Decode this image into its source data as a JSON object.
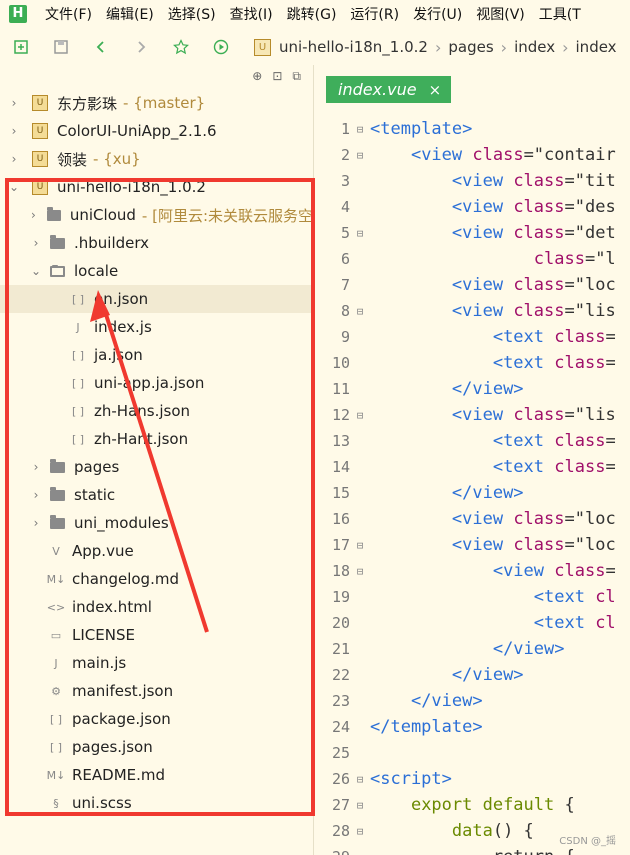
{
  "menubar": {
    "logo": "H",
    "items": [
      "文件(F)",
      "编辑(E)",
      "选择(S)",
      "查找(I)",
      "跳转(G)",
      "运行(R)",
      "发行(U)",
      "视图(V)",
      "工具(T"
    ]
  },
  "toolbar": {
    "breadcrumb": [
      "uni-hello-i18n_1.0.2",
      "pages",
      "index",
      "index"
    ]
  },
  "tree": [
    {
      "label": "东方影珠",
      "suffix": "- {master}",
      "type": "project",
      "twisty": "›"
    },
    {
      "label": "ColorUI-UniApp_2.1.6",
      "suffix": "",
      "type": "project",
      "twisty": "›"
    },
    {
      "label": "领装",
      "suffix": "- {xu}",
      "type": "project",
      "twisty": "›"
    },
    {
      "label": "uni-hello-i18n_1.0.2",
      "suffix": "",
      "type": "project",
      "twisty": "⌄"
    },
    {
      "label": "uniCloud",
      "suffix": "- [阿里云:未关联云服务空",
      "type": "folder",
      "twisty": "›"
    },
    {
      "label": ".hbuilderx",
      "suffix": "",
      "type": "folder",
      "twisty": "›"
    },
    {
      "label": "locale",
      "suffix": "",
      "type": "folder-open",
      "twisty": "⌄"
    },
    {
      "label": "en.json",
      "suffix": "",
      "type": "json",
      "twisty": ""
    },
    {
      "label": "index.js",
      "suffix": "",
      "type": "js",
      "twisty": ""
    },
    {
      "label": "ja.json",
      "suffix": "",
      "type": "json",
      "twisty": ""
    },
    {
      "label": "uni-app.ja.json",
      "suffix": "",
      "type": "json",
      "twisty": ""
    },
    {
      "label": "zh-Hans.json",
      "suffix": "",
      "type": "json",
      "twisty": ""
    },
    {
      "label": "zh-Hant.json",
      "suffix": "",
      "type": "json",
      "twisty": ""
    },
    {
      "label": "pages",
      "suffix": "",
      "type": "folder",
      "twisty": "›"
    },
    {
      "label": "static",
      "suffix": "",
      "type": "folder",
      "twisty": "›"
    },
    {
      "label": "uni_modules",
      "suffix": "",
      "type": "folder",
      "twisty": "›"
    },
    {
      "label": "App.vue",
      "suffix": "",
      "type": "vue",
      "twisty": ""
    },
    {
      "label": "changelog.md",
      "suffix": "",
      "type": "md",
      "twisty": ""
    },
    {
      "label": "index.html",
      "suffix": "",
      "type": "html",
      "twisty": ""
    },
    {
      "label": "LICENSE",
      "suffix": "",
      "type": "file",
      "twisty": ""
    },
    {
      "label": "main.js",
      "suffix": "",
      "type": "js",
      "twisty": ""
    },
    {
      "label": "manifest.json",
      "suffix": "",
      "type": "manifest",
      "twisty": ""
    },
    {
      "label": "package.json",
      "suffix": "",
      "type": "json",
      "twisty": ""
    },
    {
      "label": "pages.json",
      "suffix": "",
      "type": "json",
      "twisty": ""
    },
    {
      "label": "README.md",
      "suffix": "",
      "type": "md",
      "twisty": ""
    },
    {
      "label": "uni.scss",
      "suffix": "",
      "type": "scss",
      "twisty": ""
    }
  ],
  "editor": {
    "tab_label": "index.vue",
    "tab_close": "×",
    "lines": [
      {
        "n": "1",
        "fold": "⊟",
        "parts": [
          [
            "tag",
            "<template>"
          ]
        ]
      },
      {
        "n": "2",
        "fold": "⊟",
        "parts": [
          [
            "code",
            "    "
          ],
          [
            "tag",
            "<view "
          ],
          [
            "attr",
            "class"
          ],
          [
            "code",
            "=\"contair"
          ]
        ]
      },
      {
        "n": "3",
        "fold": "",
        "parts": [
          [
            "code",
            "        "
          ],
          [
            "tag",
            "<view "
          ],
          [
            "attr",
            "class"
          ],
          [
            "code",
            "=\"tit"
          ]
        ]
      },
      {
        "n": "4",
        "fold": "",
        "parts": [
          [
            "code",
            "        "
          ],
          [
            "tag",
            "<view "
          ],
          [
            "attr",
            "class"
          ],
          [
            "code",
            "=\"des"
          ]
        ]
      },
      {
        "n": "5",
        "fold": "⊟",
        "parts": [
          [
            "code",
            "        "
          ],
          [
            "tag",
            "<view "
          ],
          [
            "attr",
            "class"
          ],
          [
            "code",
            "=\"det"
          ]
        ]
      },
      {
        "n": "6",
        "fold": "",
        "parts": [
          [
            "code",
            "                "
          ],
          [
            "attr",
            "class"
          ],
          [
            "code",
            "=\"l"
          ]
        ]
      },
      {
        "n": "7",
        "fold": "",
        "parts": [
          [
            "code",
            "        "
          ],
          [
            "tag",
            "<view "
          ],
          [
            "attr",
            "class"
          ],
          [
            "code",
            "=\"loc"
          ]
        ]
      },
      {
        "n": "8",
        "fold": "⊟",
        "parts": [
          [
            "code",
            "        "
          ],
          [
            "tag",
            "<view "
          ],
          [
            "attr",
            "class"
          ],
          [
            "code",
            "=\"lis"
          ]
        ]
      },
      {
        "n": "9",
        "fold": "",
        "parts": [
          [
            "code",
            "            "
          ],
          [
            "tag",
            "<text "
          ],
          [
            "attr",
            "class"
          ],
          [
            "code",
            "="
          ]
        ]
      },
      {
        "n": "10",
        "fold": "",
        "parts": [
          [
            "code",
            "            "
          ],
          [
            "tag",
            "<text "
          ],
          [
            "attr",
            "class"
          ],
          [
            "code",
            "="
          ]
        ]
      },
      {
        "n": "11",
        "fold": "",
        "parts": [
          [
            "code",
            "        "
          ],
          [
            "tag",
            "</view>"
          ]
        ]
      },
      {
        "n": "12",
        "fold": "⊟",
        "parts": [
          [
            "code",
            "        "
          ],
          [
            "tag",
            "<view "
          ],
          [
            "attr",
            "class"
          ],
          [
            "code",
            "=\"lis"
          ]
        ]
      },
      {
        "n": "13",
        "fold": "",
        "parts": [
          [
            "code",
            "            "
          ],
          [
            "tag",
            "<text "
          ],
          [
            "attr",
            "class"
          ],
          [
            "code",
            "="
          ]
        ]
      },
      {
        "n": "14",
        "fold": "",
        "parts": [
          [
            "code",
            "            "
          ],
          [
            "tag",
            "<text "
          ],
          [
            "attr",
            "class"
          ],
          [
            "code",
            "="
          ]
        ]
      },
      {
        "n": "15",
        "fold": "",
        "parts": [
          [
            "code",
            "        "
          ],
          [
            "tag",
            "</view>"
          ]
        ]
      },
      {
        "n": "16",
        "fold": "",
        "parts": [
          [
            "code",
            "        "
          ],
          [
            "tag",
            "<view "
          ],
          [
            "attr",
            "class"
          ],
          [
            "code",
            "=\"loc"
          ]
        ]
      },
      {
        "n": "17",
        "fold": "⊟",
        "parts": [
          [
            "code",
            "        "
          ],
          [
            "tag",
            "<view "
          ],
          [
            "attr",
            "class"
          ],
          [
            "code",
            "=\"loc"
          ]
        ]
      },
      {
        "n": "18",
        "fold": "⊟",
        "parts": [
          [
            "code",
            "            "
          ],
          [
            "tag",
            "<view "
          ],
          [
            "attr",
            "class"
          ],
          [
            "code",
            "="
          ]
        ]
      },
      {
        "n": "19",
        "fold": "",
        "parts": [
          [
            "code",
            "                "
          ],
          [
            "tag",
            "<text "
          ],
          [
            "attr",
            "cl"
          ]
        ]
      },
      {
        "n": "20",
        "fold": "",
        "parts": [
          [
            "code",
            "                "
          ],
          [
            "tag",
            "<text "
          ],
          [
            "attr",
            "cl"
          ]
        ]
      },
      {
        "n": "21",
        "fold": "",
        "parts": [
          [
            "code",
            "            "
          ],
          [
            "tag",
            "</view>"
          ]
        ]
      },
      {
        "n": "22",
        "fold": "",
        "parts": [
          [
            "code",
            "        "
          ],
          [
            "tag",
            "</view>"
          ]
        ]
      },
      {
        "n": "23",
        "fold": "",
        "parts": [
          [
            "code",
            "    "
          ],
          [
            "tag",
            "</view>"
          ]
        ]
      },
      {
        "n": "24",
        "fold": "",
        "parts": [
          [
            "tag",
            "</template>"
          ]
        ]
      },
      {
        "n": "25",
        "fold": "",
        "parts": []
      },
      {
        "n": "26",
        "fold": "⊟",
        "parts": [
          [
            "tag",
            "<script>"
          ]
        ]
      },
      {
        "n": "27",
        "fold": "⊟",
        "parts": [
          [
            "code",
            "    "
          ],
          [
            "kw",
            "export default"
          ],
          [
            "code",
            " {"
          ]
        ]
      },
      {
        "n": "28",
        "fold": "⊟",
        "parts": [
          [
            "code",
            "        "
          ],
          [
            "kw",
            "data"
          ],
          [
            "code",
            "() {"
          ]
        ]
      },
      {
        "n": "29",
        "fold": "",
        "parts": [
          [
            "code",
            "            return {"
          ]
        ]
      }
    ]
  },
  "watermark": "CSDN @_摇",
  "colors": {
    "highlight": "#f0392f",
    "tab": "#3fae5b",
    "background": "#fffae8"
  }
}
